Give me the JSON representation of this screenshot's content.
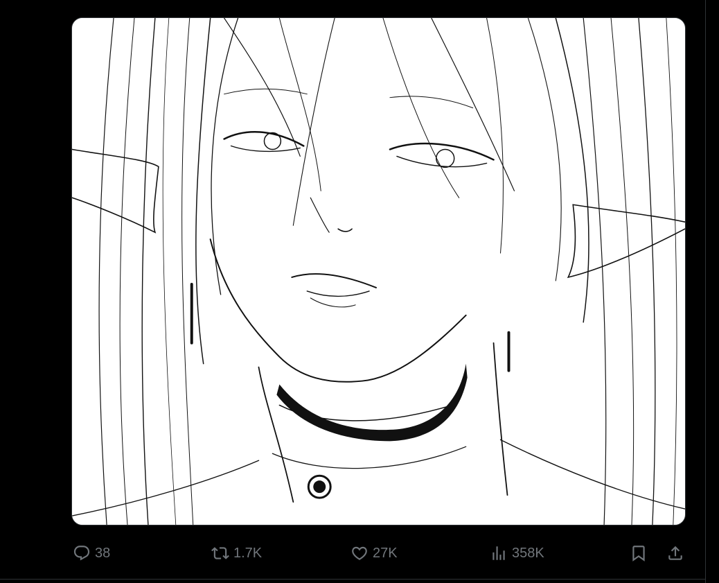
{
  "tweet": {
    "media": {
      "alt_icon": "elf-sketch-illustration"
    },
    "actions": {
      "replies": "38",
      "reposts": "1.7K",
      "likes": "27K",
      "views": "358K"
    },
    "icons": {
      "reply": "reply-icon",
      "repost": "repost-icon",
      "like": "heart-icon",
      "views": "views-icon",
      "bookmark": "bookmark-icon",
      "share": "share-icon"
    },
    "colors": {
      "background": "#000000",
      "icon_gray": "#71767b",
      "border": "#2f3336"
    }
  }
}
